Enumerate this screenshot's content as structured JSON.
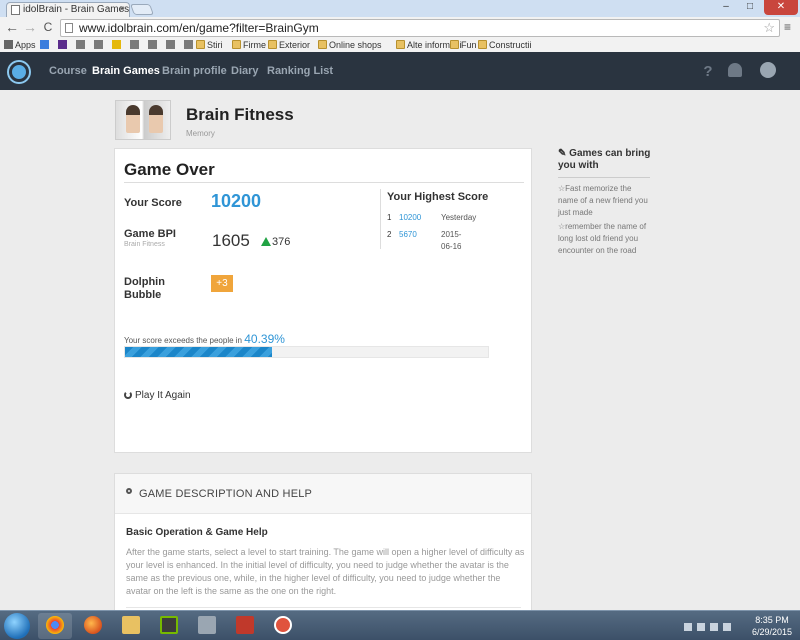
{
  "browser": {
    "tab_title": "idolBrain - Brain Games &",
    "tab_close": "×",
    "url": "www.idolbrain.com/en/game?filter=BrainGym",
    "window_controls": {
      "minimize": "–",
      "maximize": "□",
      "close": "✕"
    },
    "nav": {
      "back": "←",
      "forward": "→",
      "reload": "C"
    },
    "star": "☆",
    "menu": "≡",
    "bookmarks": [
      {
        "label": "Apps",
        "icon": "apps-icon"
      },
      {
        "label": "",
        "icon": "bookmark-g-icon"
      },
      {
        "label": "",
        "icon": "bookmark-y-icon"
      },
      {
        "label": "",
        "icon": "bookmark-icon"
      },
      {
        "label": "",
        "icon": "bookmark-icon"
      },
      {
        "label": "",
        "icon": "bookmark-imdb-icon"
      },
      {
        "label": "",
        "icon": "bookmark-icon"
      },
      {
        "label": "",
        "icon": "bookmark-icon"
      },
      {
        "label": "",
        "icon": "bookmark-icon"
      },
      {
        "label": "",
        "icon": "bookmark-icon"
      },
      {
        "label": "Stiri",
        "icon": "folder-icon"
      },
      {
        "label": "Firme",
        "icon": "folder-icon"
      },
      {
        "label": "Exterior",
        "icon": "folder-icon"
      },
      {
        "label": "Online shops",
        "icon": "folder-icon"
      },
      {
        "label": "Alte informatii",
        "icon": "folder-icon"
      },
      {
        "label": "Fun",
        "icon": "folder-icon"
      },
      {
        "label": "Constructii",
        "icon": "folder-icon"
      }
    ]
  },
  "site_nav": {
    "links": [
      "Course",
      "Brain Games",
      "Brain profile",
      "Diary",
      "Ranking List"
    ],
    "active": "Brain Games",
    "help_icon": "?"
  },
  "game": {
    "title": "Brain Fitness",
    "category": "Memory"
  },
  "result": {
    "heading": "Game Over",
    "score_label": "Your Score",
    "score": "10200",
    "bpi_label": "Game BPI",
    "bpi_sub": "Brain Fitness",
    "bpi": "1605",
    "bpi_change": "376",
    "bonus_label_1": "Dolphin",
    "bonus_label_2": "Bubble",
    "bonus": "+3",
    "highest_title": "Your Highest Score",
    "highest": [
      {
        "rank": "1",
        "score": "10200",
        "date": "Yesterday"
      },
      {
        "rank": "2",
        "score": "5670",
        "date": "2015-06-16"
      }
    ],
    "exceed_text": "Your score exceeds the people in",
    "exceed_pct": "40.39%",
    "exceed_value": 40.39,
    "play_again": "Play It Again"
  },
  "help": {
    "title": "GAME DESCRIPTION AND HELP",
    "subtitle": "Basic Operation & Game Help",
    "body": "After the game starts, select a level to start training. The game will open a higher level of difficulty as your level is enhanced. In the initial level of difficulty, you need to judge whether the avatar is the same as the previous one, while, in the higher level of difficulty, you need to judge whether the avatar on the left is the same as the one on the right."
  },
  "sidebar": {
    "title": "Games can bring you with",
    "items": [
      "☆Fast memorize the name of a new friend you just made",
      "☆remember the name of long lost old friend you encounter on the road"
    ]
  },
  "taskbar": {
    "time": "8:35 PM",
    "date": "6/29/2015",
    "apps": [
      "chrome-icon",
      "firefox-icon",
      "explorer-icon",
      "nvidia-icon",
      "m-app-icon",
      "app-120x-icon",
      "app-icon"
    ]
  },
  "colors": {
    "accent": "#2f95d6",
    "nav_bg": "#2a3440",
    "bonus": "#f0a53b",
    "up": "#21a344"
  }
}
